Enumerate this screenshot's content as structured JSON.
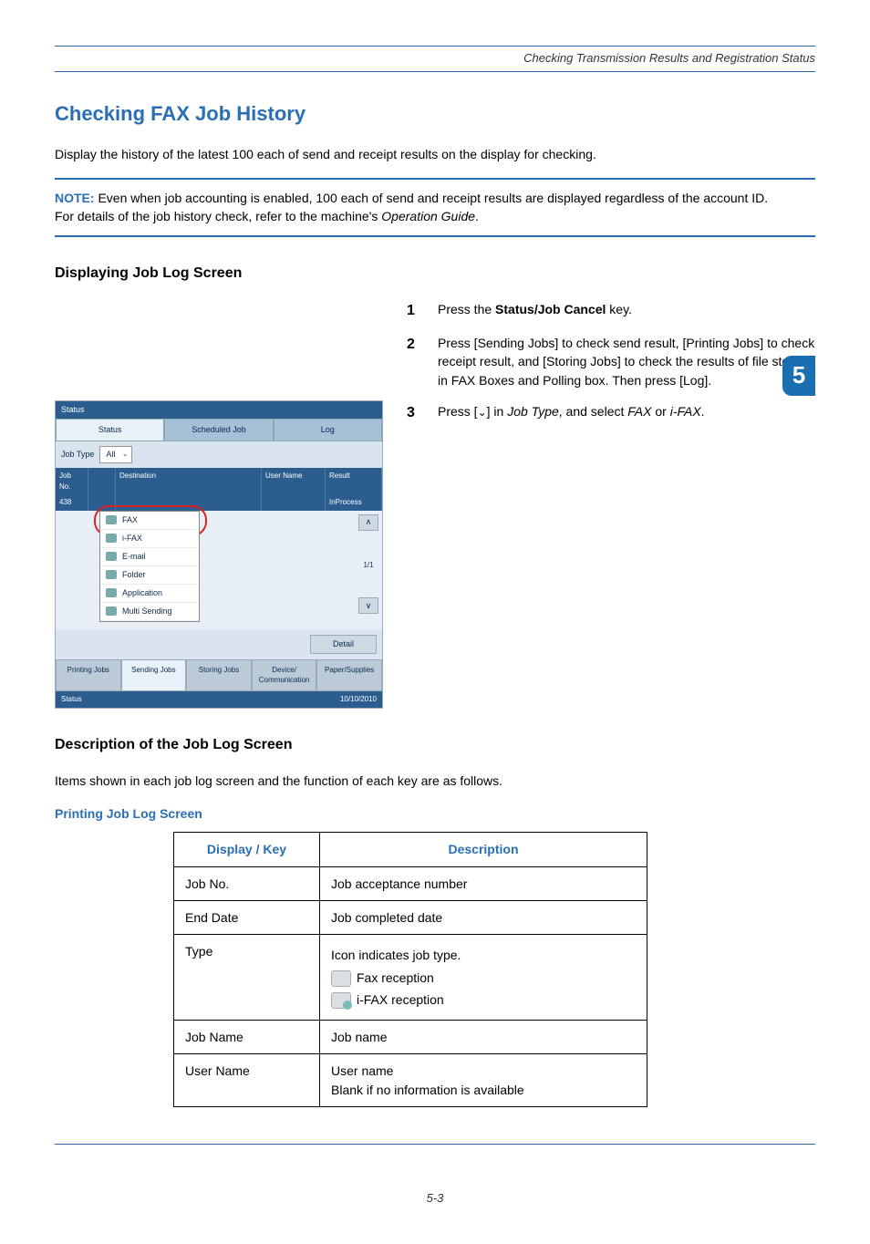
{
  "header": {
    "running_title": "Checking Transmission Results and Registration Status"
  },
  "side_badge": "5",
  "title": "Checking FAX Job History",
  "intro": "Display the history of the latest 100 each of send and receipt results on the display for checking.",
  "note": {
    "label": "NOTE:",
    "line1": " Even when job accounting is enabled, 100 each of send and receipt results are displayed regardless of the account ID.",
    "line2_a": "For details of the job history check, refer to the machine's ",
    "line2_b": "Operation Guide",
    "line2_c": "."
  },
  "subhead1": "Displaying Job Log Screen",
  "steps": [
    {
      "n": "1",
      "parts": [
        {
          "t": "Press the ",
          "b": false,
          "i": false
        },
        {
          "t": "Status/Job Cancel",
          "b": true,
          "i": false
        },
        {
          "t": " key.",
          "b": false,
          "i": false
        }
      ]
    },
    {
      "n": "2",
      "parts": [
        {
          "t": "Press [Sending Jobs] to check send result, [Printing Jobs] to check receipt result, and [Storing Jobs] to check the results of file storage in FAX Boxes and Polling box. Then press [Log].",
          "b": false,
          "i": false
        }
      ]
    },
    {
      "n": "3",
      "parts": [
        {
          "t": "Press [",
          "b": false,
          "i": false
        },
        {
          "t": "⌄",
          "b": false,
          "i": false,
          "cls": "chev-glyph"
        },
        {
          "t": "] in ",
          "b": false,
          "i": false
        },
        {
          "t": "Job Type",
          "b": false,
          "i": true
        },
        {
          "t": ", and select ",
          "b": false,
          "i": false
        },
        {
          "t": "FAX",
          "b": false,
          "i": true
        },
        {
          "t": " or ",
          "b": false,
          "i": false
        },
        {
          "t": "i-FAX",
          "b": false,
          "i": true
        },
        {
          "t": ".",
          "b": false,
          "i": false
        }
      ]
    }
  ],
  "shot": {
    "title": "Status",
    "tabs_top": [
      "Status",
      "Scheduled Job",
      "Log"
    ],
    "jobtype_label": "Job Type",
    "dd_selected": "All",
    "dd_options": [
      "FAX",
      "i-FAX",
      "E-mail",
      "Folder",
      "Application",
      "Multi Sending"
    ],
    "cols": {
      "no": "Job No.",
      "at": "",
      "dest": "Destination",
      "user": "User Name",
      "res": "Result"
    },
    "row": {
      "no": "438",
      "dest": "",
      "user": "",
      "res": "InProcess"
    },
    "pager": {
      "up": "∧",
      "count": "1/1",
      "down": "∨"
    },
    "detail_btn": "Detail",
    "tabs_bottom": [
      "Printing Jobs",
      "Sending Jobs",
      "Storing Jobs",
      "Device/\nCommunication",
      "Paper/Supplies"
    ],
    "footer_left": "Status",
    "footer_right": "10/10/2010"
  },
  "subhead2": "Description of the Job Log Screen",
  "desc_intro": "Items shown in each job log screen and the function of each key are as follows.",
  "blue_sub": "Printing Job Log Screen",
  "table": {
    "head": [
      "Display / Key",
      "Description"
    ],
    "rows": [
      {
        "k": "Job No.",
        "v": "Job acceptance number"
      },
      {
        "k": "End Date",
        "v": "Job completed date"
      },
      {
        "k": "Type",
        "v_lines": [
          "Icon indicates job type.",
          "Fax reception",
          "i-FAX reception"
        ],
        "icons": true
      },
      {
        "k": "Job Name",
        "v": "Job name"
      },
      {
        "k": "User Name",
        "v": "User name\nBlank if no information is available"
      }
    ]
  },
  "page_number": "5-3"
}
